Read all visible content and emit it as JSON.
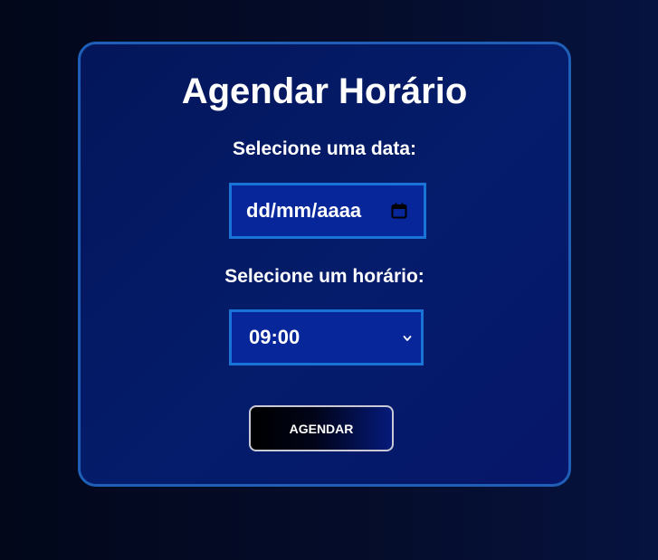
{
  "page": {
    "title": "Agendar Horário"
  },
  "form": {
    "date_label": "Selecione uma data:",
    "date_placeholder": "dd/mm/aaaa",
    "time_label": "Selecione um horário:",
    "time_selected": "09:00",
    "submit_label": "AGENDAR"
  },
  "icons": {
    "date_picker": "calendar-icon",
    "select_arrow": "chevron-down-icon"
  },
  "colors": {
    "card_background": "#041c6b",
    "card_border": "#1f5fb8",
    "field_background": "#06269a",
    "field_border": "#1a73d6"
  }
}
